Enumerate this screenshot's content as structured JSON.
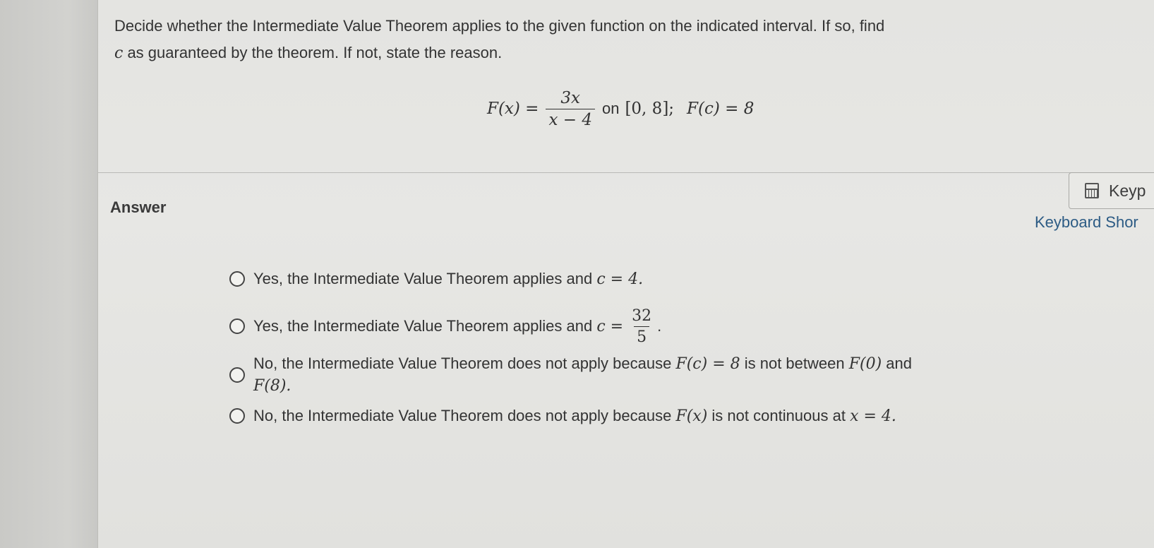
{
  "question": {
    "line1": "Decide whether the Intermediate Value Theorem applies to the given function on the indicated interval. If so, find",
    "line2_var": "c",
    "line2_rest": " as guaranteed by the theorem. If not, state the reason."
  },
  "equation": {
    "lhs": "F(x) =",
    "numerator": "3x",
    "denominator": "x − 4",
    "on_word": "on",
    "interval": "[0, 8];",
    "condition": "F(c) = 8"
  },
  "answer_label": "Answer",
  "keypad": {
    "label": "Keyp",
    "icon": "calculator-icon"
  },
  "keyboard_shortcuts": "Keyboard Shor",
  "options": [
    {
      "text": "Yes, the Intermediate Value Theorem applies and ",
      "math": "c = 4."
    },
    {
      "text": "Yes, the Intermediate Value Theorem applies and ",
      "math": "c =",
      "numerator": "32",
      "denominator": "5",
      "end": "."
    },
    {
      "text_a": "No, the Intermediate Value Theorem does not apply because ",
      "math_a": "F(c) = 8",
      "text_b": " is not between ",
      "math_b": "F(0)",
      "text_c": " and",
      "math_c": "F(8)."
    },
    {
      "text_a": "No, the Intermediate Value Theorem does not apply because ",
      "math_a": "F(x)",
      "text_b": " is not continuous at ",
      "math_b": "x = 4."
    }
  ],
  "colors": {
    "link": "#2c5b84",
    "background": "#e5e5e2"
  }
}
